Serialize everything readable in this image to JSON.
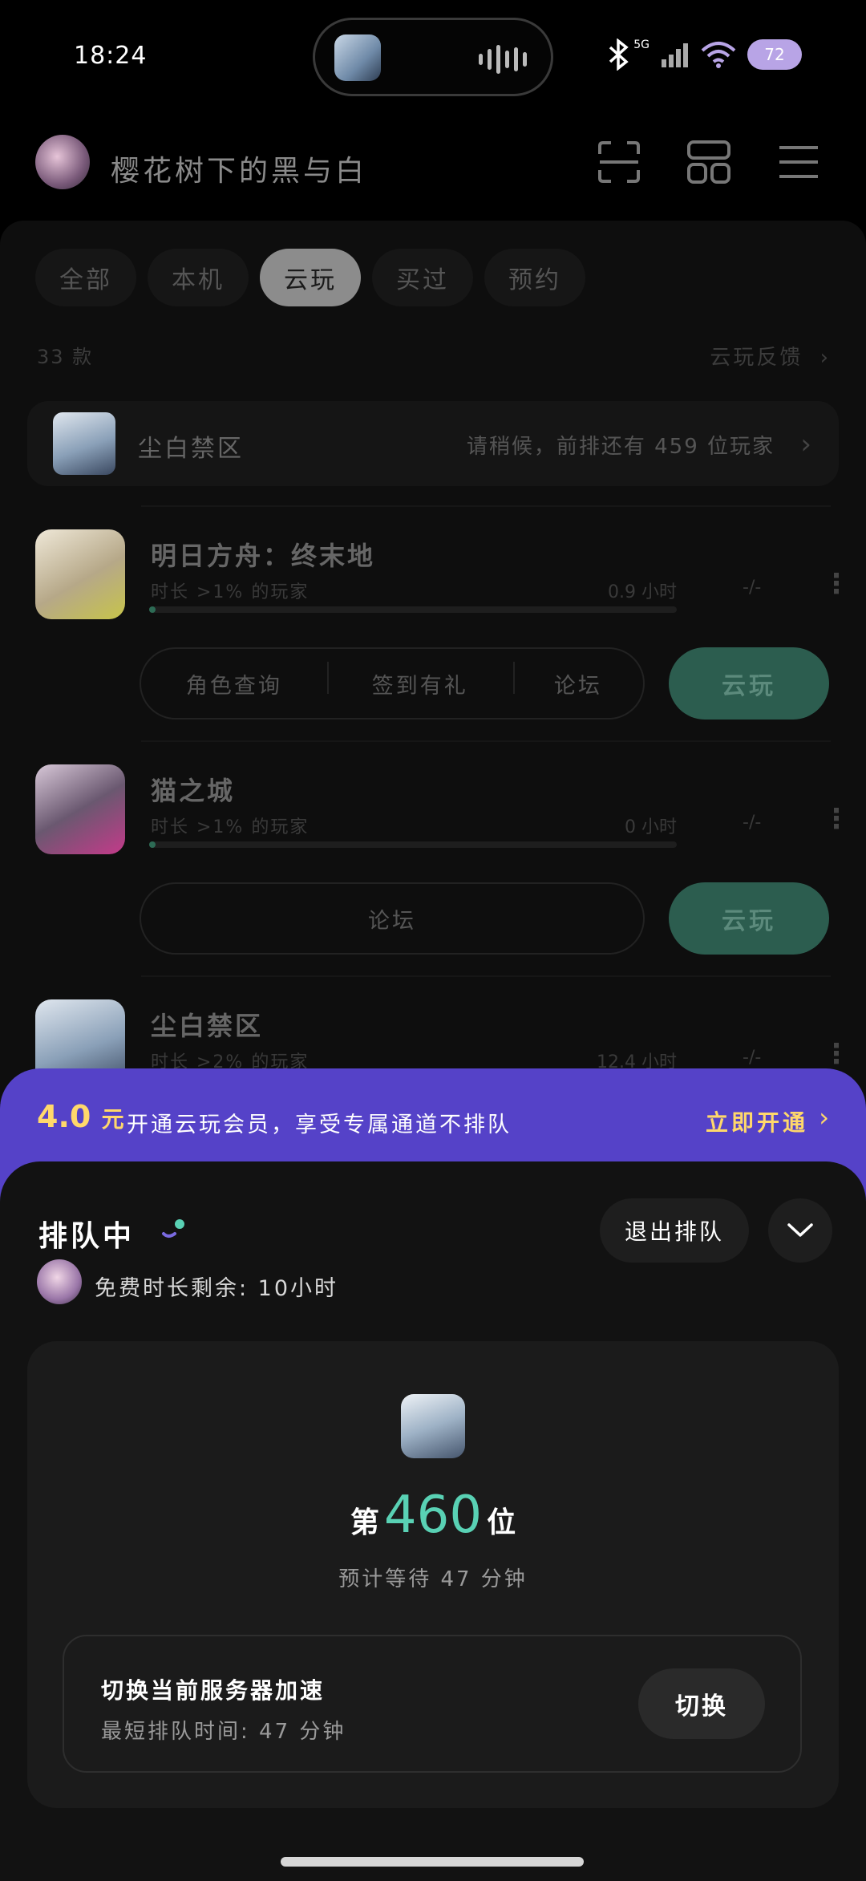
{
  "status_bar": {
    "time": "18:24",
    "network": "5G",
    "battery": "72",
    "icons": [
      "bluetooth-icon",
      "signal-icon",
      "wifi-icon",
      "battery-icon"
    ]
  },
  "header": {
    "title": "樱花树下的黑与白",
    "icons": [
      "scan-icon",
      "apps-icon",
      "menu-icon"
    ]
  },
  "tabs": [
    {
      "label": "全部",
      "active": false
    },
    {
      "label": "本机",
      "active": false
    },
    {
      "label": "云玩",
      "active": true
    },
    {
      "label": "买过",
      "active": false
    },
    {
      "label": "预约",
      "active": false
    }
  ],
  "list": {
    "count": "33 款",
    "feedback": "云玩反馈"
  },
  "queue_card": {
    "name": "尘白禁区",
    "info": "请稍候，前排还有 459 位玩家"
  },
  "games": [
    {
      "name": "明日方舟：终末地",
      "subtitle": "时长 >1% 的玩家",
      "hours": "0.9 小时",
      "dash": "-/-",
      "playtime_fraction": 0.01,
      "actions": [
        "角色查询",
        "签到有礼",
        "论坛"
      ],
      "play": "云玩"
    },
    {
      "name": "猫之城",
      "subtitle": "时长 >1% 的玩家",
      "hours": "0 小时",
      "dash": "-/-",
      "playtime_fraction": 0.01,
      "actions": [
        "论坛"
      ],
      "play": "云玩"
    },
    {
      "name": "尘白禁区",
      "subtitle": "时长 >2% 的玩家",
      "hours": "12.4 小时",
      "dash": "-/-"
    }
  ],
  "promo": {
    "price": "4.0",
    "unit": "元",
    "text": "开通云玩会员，享受专属通道不排队",
    "cta": "立即开通",
    "accent": "#ffd86b",
    "bg": "#5542c8"
  },
  "queue_sheet": {
    "title": "排队中",
    "free_time": "免费时长剩余: 10小时",
    "exit": "退出排队",
    "rank_prefix": "第",
    "rank": "460",
    "rank_suffix": "位",
    "estimate": "预计等待 47 分钟",
    "server_title": "切换当前服务器加速",
    "server_sub": "最短排队时间: 47 分钟",
    "switch": "切换",
    "accent": "#59d1b4"
  }
}
